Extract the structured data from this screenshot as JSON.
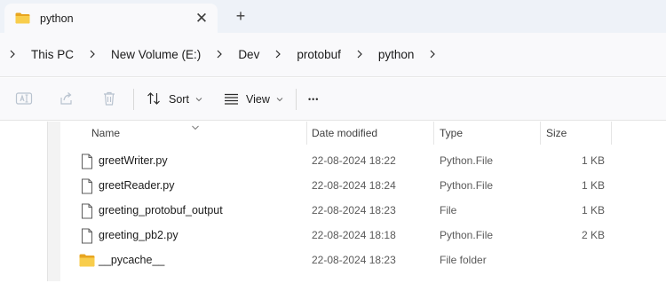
{
  "window": {
    "tab_title": "python",
    "close_glyph": "✕",
    "new_tab_glyph": "+",
    "tab_icon": "folder-icon"
  },
  "breadcrumb": {
    "items": [
      "This PC",
      "New Volume (E:)",
      "Dev",
      "protobuf",
      "python"
    ]
  },
  "toolbar": {
    "sort_label": "Sort",
    "view_label": "View",
    "more_glyph": "•••"
  },
  "columns": {
    "name": "Name",
    "date": "Date modified",
    "type": "Type",
    "size": "Size"
  },
  "files": [
    {
      "name": "greetWriter.py",
      "date": "22-08-2024 18:22",
      "type": "Python.File",
      "size": "1 KB",
      "icon": "file-icon"
    },
    {
      "name": "greetReader.py",
      "date": "22-08-2024 18:24",
      "type": "Python.File",
      "size": "1 KB",
      "icon": "file-icon"
    },
    {
      "name": "greeting_protobuf_output",
      "date": "22-08-2024 18:23",
      "type": "File",
      "size": "1 KB",
      "icon": "file-icon"
    },
    {
      "name": "greeting_pb2.py",
      "date": "22-08-2024 18:18",
      "type": "Python.File",
      "size": "2 KB",
      "icon": "file-icon"
    },
    {
      "name": "__pycache__",
      "date": "22-08-2024 18:23",
      "type": "File folder",
      "size": "",
      "icon": "folder-icon"
    }
  ],
  "colors": {
    "folder_yellow": "#f4c430",
    "tabstrip_bg": "#eef2f8",
    "bar_bg": "#f9f9fb"
  }
}
